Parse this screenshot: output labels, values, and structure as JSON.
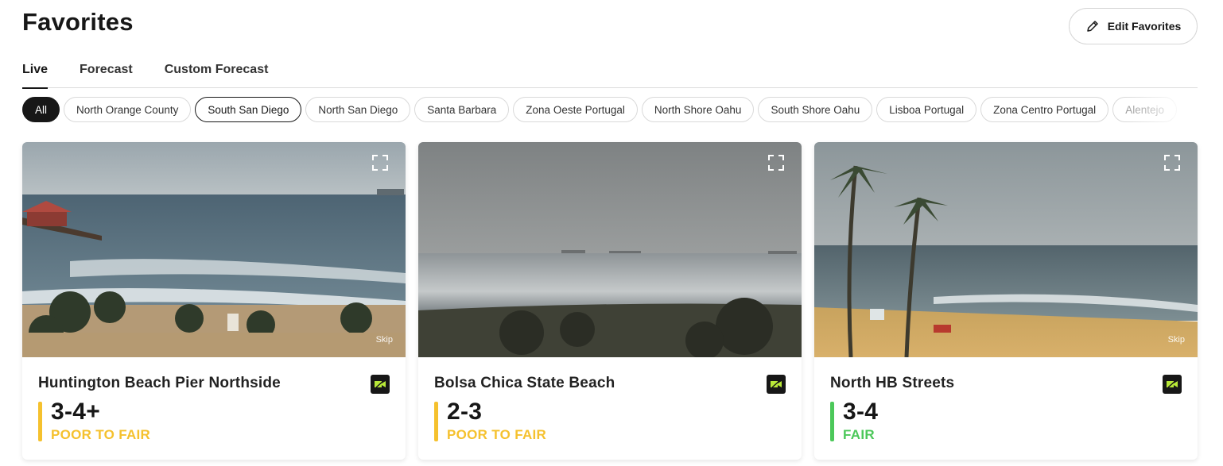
{
  "page": {
    "title": "Favorites"
  },
  "header": {
    "edit_label": "Edit Favorites"
  },
  "tabs": [
    {
      "label": "Live",
      "active": true
    },
    {
      "label": "Forecast",
      "active": false
    },
    {
      "label": "Custom Forecast",
      "active": false
    }
  ],
  "filters": [
    {
      "label": "All",
      "state": "selected"
    },
    {
      "label": "North Orange County",
      "state": "default"
    },
    {
      "label": "South San Diego",
      "state": "outlined"
    },
    {
      "label": "North San Diego",
      "state": "default"
    },
    {
      "label": "Santa Barbara",
      "state": "default"
    },
    {
      "label": "Zona Oeste Portugal",
      "state": "default"
    },
    {
      "label": "North Shore Oahu",
      "state": "default"
    },
    {
      "label": "South Shore Oahu",
      "state": "default"
    },
    {
      "label": "Lisboa Portugal",
      "state": "default"
    },
    {
      "label": "Zona Centro Portugal",
      "state": "default"
    },
    {
      "label": "Alentejo",
      "state": "faded"
    }
  ],
  "colors": {
    "poor_to_fair": "#f5c12e",
    "fair": "#4cc85a",
    "text_dark": "#171717"
  },
  "cards": [
    {
      "name": "Huntington Beach Pier Northside",
      "height": "3-4+",
      "condition": "POOR TO FAIR",
      "condition_color": "#f5c12e",
      "skip_label": "Skip",
      "has_skip": true,
      "expand_icon": "expand-icon",
      "badge_icon": "camera-icon"
    },
    {
      "name": "Bolsa Chica State Beach",
      "height": "2-3",
      "condition": "POOR TO FAIR",
      "condition_color": "#f5c12e",
      "skip_label": "",
      "has_skip": false,
      "expand_icon": "expand-icon",
      "badge_icon": "camera-icon"
    },
    {
      "name": "North HB Streets",
      "height": "3-4",
      "condition": "FAIR",
      "condition_color": "#4cc85a",
      "skip_label": "Skip",
      "has_skip": true,
      "expand_icon": "expand-icon",
      "badge_icon": "camera-icon"
    }
  ]
}
